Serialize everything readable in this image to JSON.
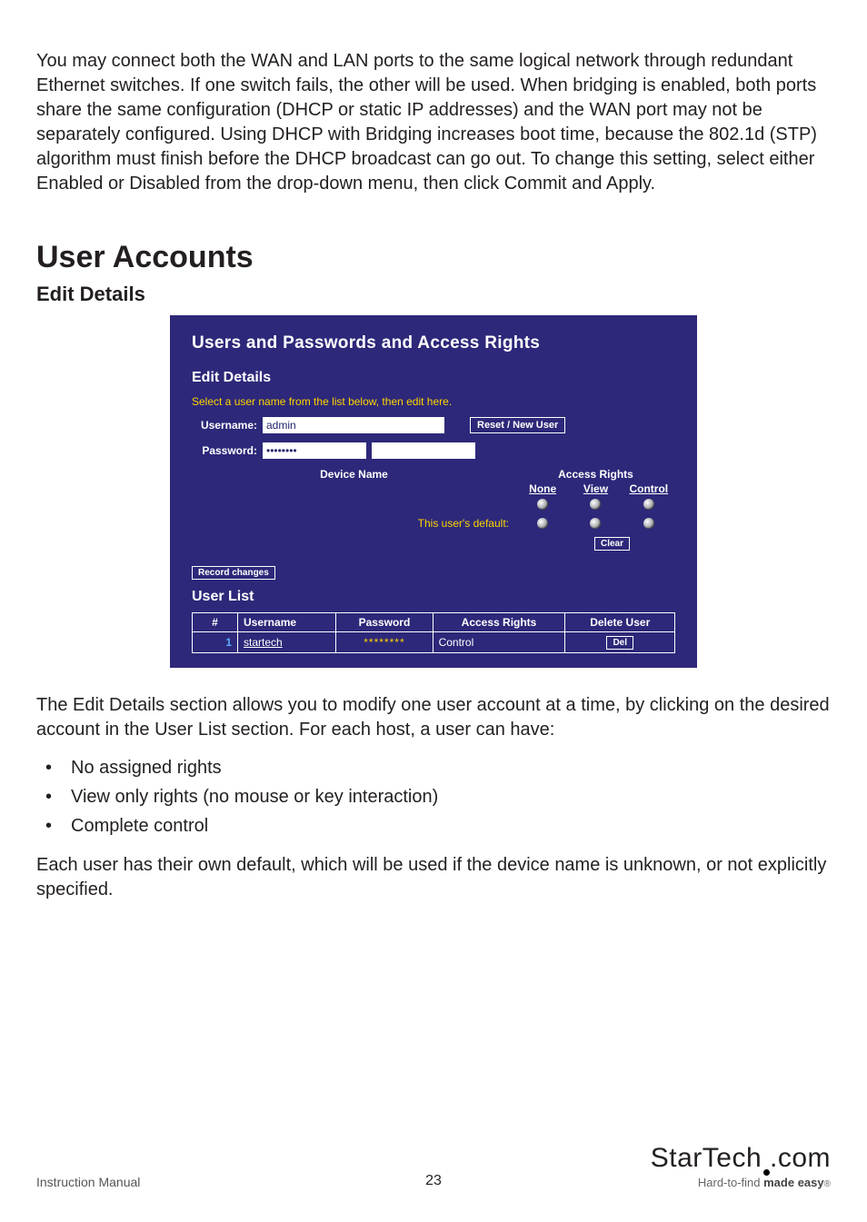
{
  "intro_para": "You may connect both the WAN and LAN ports to the same logical network through redundant Ethernet switches. If one switch fails, the other will be used. When bridging is enabled, both ports share the same configuration (DHCP or static IP addresses) and the WAN port may not be separately configured. Using DHCP with Bridging increases boot time, because the 802.1d (STP) algorithm must finish before the DHCP broadcast can go out. To change this setting, select either Enabled or Disabled from the drop-down menu, then click Commit and Apply.",
  "section_h1": "User Accounts",
  "section_h2": "Edit Details",
  "panel": {
    "title": "Users and Passwords and Access Rights",
    "sub": "Edit Details",
    "instruction": "Select a user name from the list below, then edit here.",
    "username_label": "Username:",
    "username_value": "admin",
    "reset_button": "Reset / New User",
    "password_label": "Password:",
    "password_mask": "••••••••",
    "device_name_label": "Device Name",
    "access_rights_label": "Access Rights",
    "rights_options": {
      "none": "None",
      "view": "View",
      "control": "Control"
    },
    "this_user_default": "This user's default:",
    "clear_button": "Clear",
    "record_changes_button": "Record changes",
    "user_list_title": "User List",
    "user_list_headers": {
      "num": "#",
      "username": "Username",
      "password": "Password",
      "access": "Access Rights",
      "del": "Delete User"
    },
    "user_list_rows": [
      {
        "num": "1",
        "username": "startech",
        "password": "********",
        "access": "Control",
        "del": "Del"
      }
    ]
  },
  "after_para": "The Edit Details section allows you to modify one user account at a time, by clicking on the desired account in the User List section.  For each host, a user can have:",
  "bullets": [
    "No assigned rights",
    "View only rights (no mouse or key interaction)",
    "Complete control"
  ],
  "closing_para": "Each user has their own default, which will be used if the device name is unknown, or not explicitly specified.",
  "footer": {
    "doc_label": "Instruction Manual",
    "page_number": "23",
    "brand_a": "StarTech",
    "brand_b": ".com",
    "tagline_a": "Hard-to-find ",
    "tagline_b": "made easy",
    "reg": "®"
  }
}
